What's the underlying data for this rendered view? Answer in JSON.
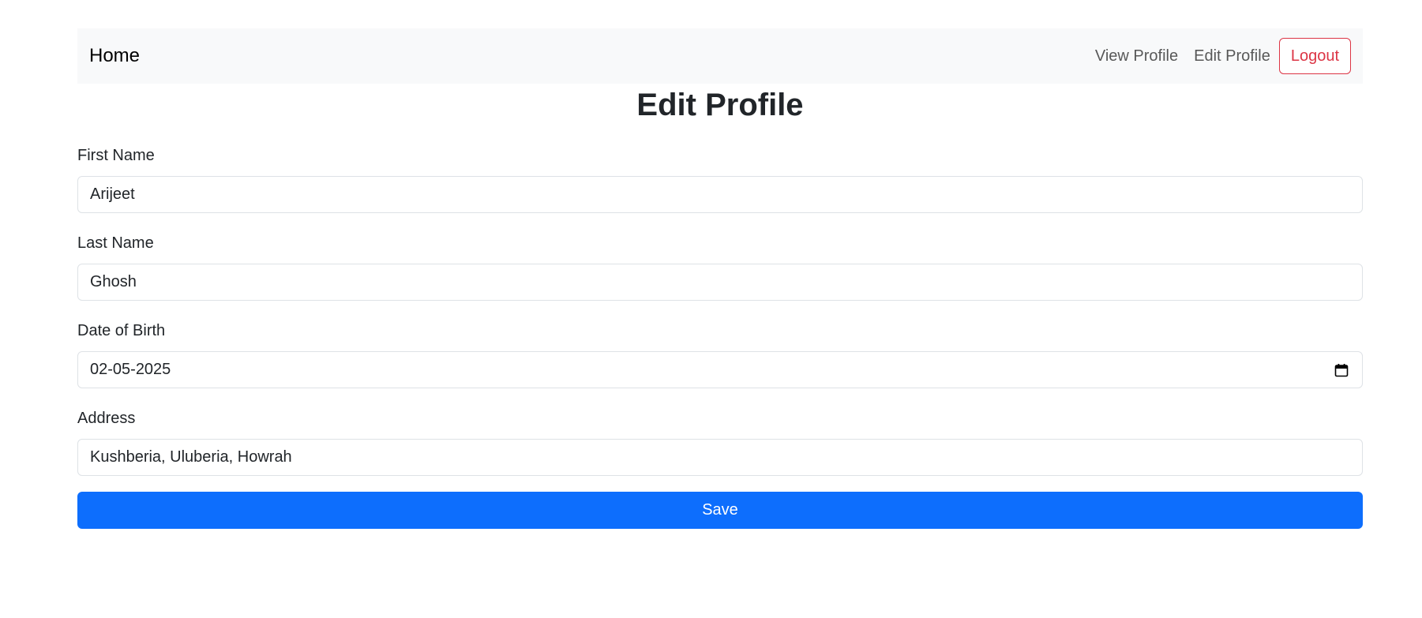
{
  "navbar": {
    "brand": "Home",
    "links": [
      {
        "label": "View Profile"
      },
      {
        "label": "Edit Profile"
      }
    ],
    "logout_label": "Logout"
  },
  "page": {
    "title": "Edit Profile"
  },
  "form": {
    "first_name": {
      "label": "First Name",
      "value": "Arijeet"
    },
    "last_name": {
      "label": "Last Name",
      "value": "Ghosh"
    },
    "dob": {
      "label": "Date of Birth",
      "value": "02-05-2025",
      "icon": "calendar-icon"
    },
    "address": {
      "label": "Address",
      "value": "Kushberia, Uluberia, Howrah"
    },
    "save_label": "Save"
  },
  "colors": {
    "primary": "#0d6efd",
    "danger": "#dc3545",
    "navbar_bg": "#f8f9fa"
  }
}
